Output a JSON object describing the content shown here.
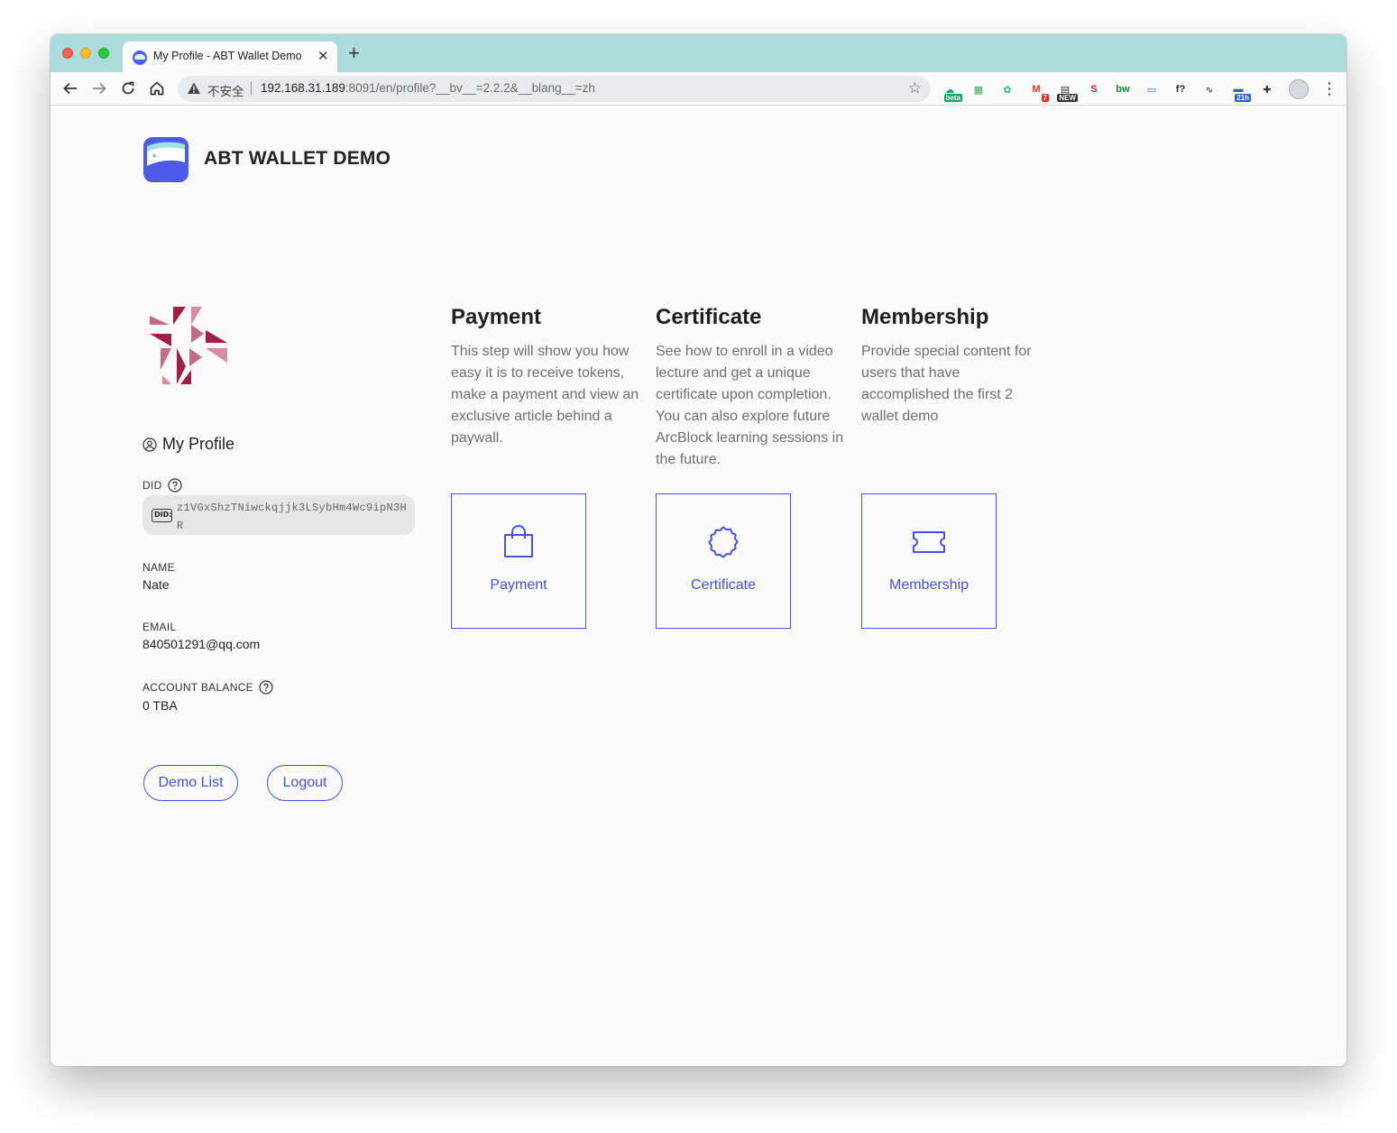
{
  "browser": {
    "tab_title": "My Profile - ABT Wallet Demo",
    "omnibox": {
      "insecure_label": "不安全",
      "url_host": "192.168.31.189",
      "url_rest": ":8091/en/profile?__bv__=2.2.2&__blang__=zh"
    },
    "extensions": [
      {
        "name": "cloud-beta-extension-icon",
        "badge": "beta",
        "color": "#1aa260"
      },
      {
        "name": "sheets-extension-icon",
        "badge": "",
        "color": "#3aa757"
      },
      {
        "name": "evernote-extension-icon",
        "badge": "",
        "color": "#2dbe60"
      },
      {
        "name": "gmail-extension-icon",
        "badge": "7",
        "color": "#d93025"
      },
      {
        "name": "news-extension-icon",
        "badge": "NEW",
        "color": "#333333"
      },
      {
        "name": "red-square-extension-icon",
        "badge": "",
        "color": "#c5221f"
      },
      {
        "name": "bw-extension-icon",
        "badge": "",
        "color": "#0f8f2f"
      },
      {
        "name": "screen-extension-icon",
        "badge": "",
        "color": "#3b73d6"
      },
      {
        "name": "font-extension-icon",
        "badge": "",
        "color": "#222222"
      },
      {
        "name": "chart-extension-icon",
        "badge": "",
        "color": "#555555"
      },
      {
        "name": "calendar-extension-icon",
        "badge": "21h",
        "color": "#2b62c7"
      },
      {
        "name": "puzzle-extension-icon",
        "badge": "",
        "color": "#333333"
      }
    ]
  },
  "header": {
    "brand": "ABT WALLET DEMO"
  },
  "profile": {
    "section_title": "My Profile",
    "did_label": "DID",
    "did_badge": "DID:",
    "did_value": "z1VGxShzTNiwckqjjk3LSybHm4Wc9ipN3HR",
    "name_label": "NAME",
    "name_value": "Nate",
    "email_label": "EMAIL",
    "email_value": "840501291@qq.com",
    "balance_label": "ACCOUNT BALANCE",
    "balance_value": "0 TBA",
    "demo_list_button": "Demo List",
    "logout_button": "Logout"
  },
  "demos": [
    {
      "title": "Payment",
      "description": "This step will show you how easy it is to receive tokens, make a payment and view an exclusive article behind a paywall.",
      "card_label": "Payment",
      "icon": "shopping-bag-icon"
    },
    {
      "title": "Certificate",
      "description": "See how to enroll in a video lecture and get a unique certificate upon completion. You can also explore future ArcBlock learning sessions in the future.",
      "card_label": "Certificate",
      "icon": "badge-icon"
    },
    {
      "title": "Membership",
      "description": "Provide special content for users that have accomplished the first 2 wallet demo",
      "card_label": "Membership",
      "icon": "ticket-icon"
    }
  ],
  "colors": {
    "accent": "#4553d9",
    "tabbar": "#abdcdb",
    "page_bg": "#fafafa"
  }
}
